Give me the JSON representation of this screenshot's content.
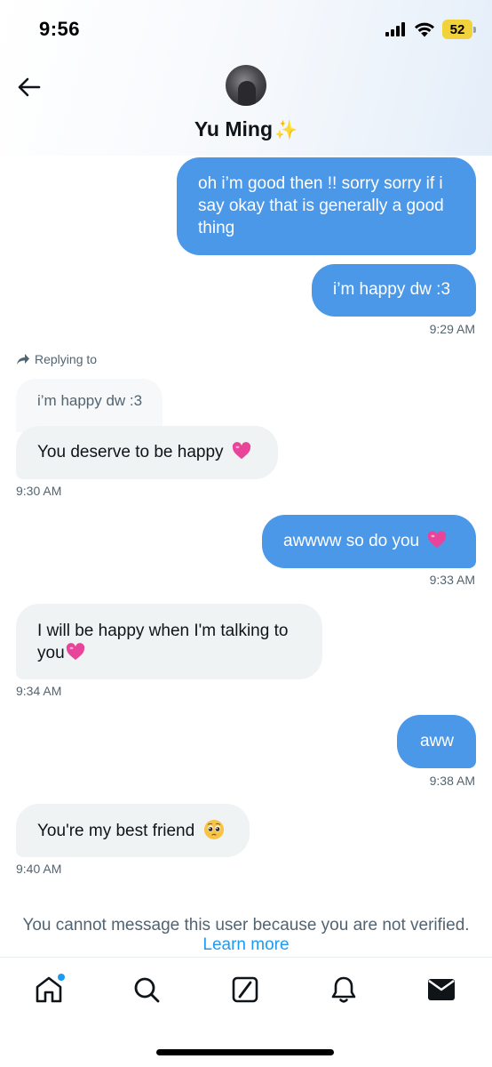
{
  "status_bar": {
    "time": "9:56",
    "battery": "52",
    "icons": [
      "cellular-signal-icon",
      "wifi-icon",
      "battery-icon"
    ]
  },
  "header": {
    "contact_name": "Yu Ming",
    "name_emoji": "✨",
    "icons": [
      "back-arrow-icon",
      "avatar"
    ]
  },
  "messages": [
    {
      "direction": "outgoing",
      "text": "oh i’m good then !! sorry sorry if i say okay that is generally a good thing"
    },
    {
      "direction": "outgoing",
      "text": "i’m happy dw :3",
      "time": "9:29 AM"
    },
    {
      "direction": "incoming",
      "reply_label": "Replying to",
      "quoted_text": "i’m happy dw :3",
      "text": "You deserve to be happy",
      "emoji": "pink-heart-icon",
      "time": "9:30 AM"
    },
    {
      "direction": "outgoing",
      "text": "awwww so do you",
      "emoji": "pink-heart-icon",
      "time": "9:33 AM"
    },
    {
      "direction": "incoming",
      "text": "I will be happy when I'm talking to",
      "text_line2": "you",
      "emoji": "pink-heart-icon",
      "time": "9:34 AM"
    },
    {
      "direction": "outgoing",
      "text": "aww",
      "time": "9:38 AM"
    },
    {
      "direction": "incoming",
      "text": "You're my best friend",
      "emoji": "pleading-face-icon",
      "time": "9:40 AM"
    }
  ],
  "notice": {
    "text": "You cannot message this user because you are not verified.",
    "link": "Learn more"
  },
  "tabbar": {
    "tabs": [
      "home-icon",
      "search-icon",
      "grok-icon",
      "notifications-icon",
      "messages-icon"
    ]
  },
  "colors": {
    "outgoing_bubble": "#4b97e8",
    "incoming_bubble": "#eff3f4",
    "link": "#1d9bf0",
    "battery": "#f2d23b",
    "heart": "#e8459a"
  }
}
